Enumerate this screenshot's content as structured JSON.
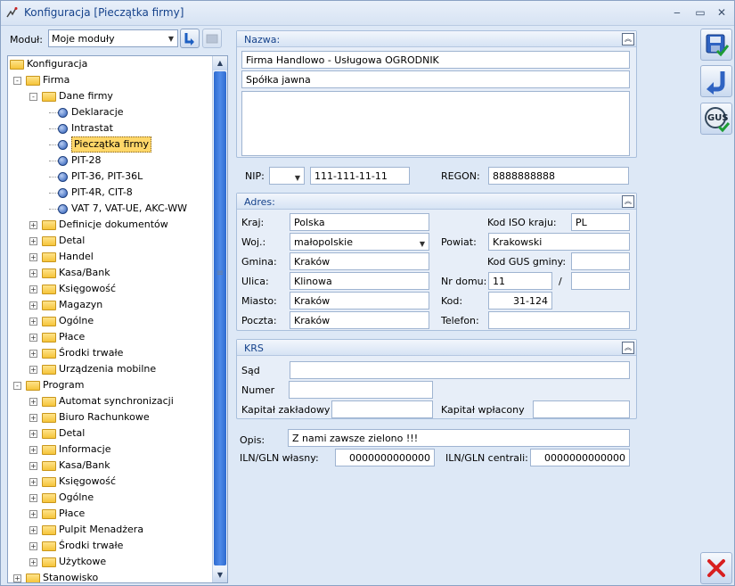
{
  "window": {
    "title": "Konfiguracja [Pieczątka firmy]",
    "controls": [
      "minimize",
      "maximize",
      "close"
    ]
  },
  "module": {
    "label": "Moduł:",
    "value": "Moje moduły"
  },
  "tree": {
    "items": [
      {
        "label": "Konfiguracja",
        "icon": "folder-icon",
        "level": 0
      },
      {
        "label": "Firma",
        "icon": "folder-icon",
        "level": 1,
        "expander": "-"
      },
      {
        "label": "Dane firmy",
        "icon": "folder-icon",
        "level": 2,
        "expander": "-"
      },
      {
        "label": "Deklaracje",
        "icon": "gear-icon",
        "level": 3
      },
      {
        "label": "Intrastat",
        "icon": "gear-icon",
        "level": 3
      },
      {
        "label": "Pieczątka firmy",
        "icon": "gear-icon",
        "level": 3,
        "selected": true
      },
      {
        "label": "PIT-28",
        "icon": "gear-icon",
        "level": 3
      },
      {
        "label": "PIT-36, PIT-36L",
        "icon": "gear-icon",
        "level": 3
      },
      {
        "label": "PIT-4R, CIT-8",
        "icon": "gear-icon",
        "level": 3
      },
      {
        "label": "VAT 7, VAT-UE, AKC-WW",
        "icon": "gear-icon",
        "level": 3
      },
      {
        "label": "Definicje dokumentów",
        "icon": "folder-icon",
        "level": 2,
        "expander": "+"
      },
      {
        "label": "Detal",
        "icon": "folder-icon",
        "level": 2,
        "expander": "+"
      },
      {
        "label": "Handel",
        "icon": "folder-icon",
        "level": 2,
        "expander": "+"
      },
      {
        "label": "Kasa/Bank",
        "icon": "folder-icon",
        "level": 2,
        "expander": "+"
      },
      {
        "label": "Księgowość",
        "icon": "folder-icon",
        "level": 2,
        "expander": "+"
      },
      {
        "label": "Magazyn",
        "icon": "folder-icon",
        "level": 2,
        "expander": "+"
      },
      {
        "label": "Ogólne",
        "icon": "folder-icon",
        "level": 2,
        "expander": "+"
      },
      {
        "label": "Płace",
        "icon": "folder-icon",
        "level": 2,
        "expander": "+"
      },
      {
        "label": "Środki trwałe",
        "icon": "folder-icon",
        "level": 2,
        "expander": "+"
      },
      {
        "label": "Urządzenia mobilne",
        "icon": "folder-icon",
        "level": 2,
        "expander": "+"
      },
      {
        "label": "Program",
        "icon": "folder-icon",
        "level": 1,
        "expander": "-"
      },
      {
        "label": "Automat synchronizacji",
        "icon": "folder-icon",
        "level": 2,
        "expander": "+"
      },
      {
        "label": "Biuro Rachunkowe",
        "icon": "folder-icon",
        "level": 2,
        "expander": "+"
      },
      {
        "label": "Detal",
        "icon": "folder-icon",
        "level": 2,
        "expander": "+"
      },
      {
        "label": "Informacje",
        "icon": "folder-icon",
        "level": 2,
        "expander": "+"
      },
      {
        "label": "Kasa/Bank",
        "icon": "folder-icon",
        "level": 2,
        "expander": "+"
      },
      {
        "label": "Księgowość",
        "icon": "folder-icon",
        "level": 2,
        "expander": "+"
      },
      {
        "label": "Ogólne",
        "icon": "folder-icon",
        "level": 2,
        "expander": "+"
      },
      {
        "label": "Płace",
        "icon": "folder-icon",
        "level": 2,
        "expander": "+"
      },
      {
        "label": "Pulpit Menadżera",
        "icon": "folder-icon",
        "level": 2,
        "expander": "+"
      },
      {
        "label": "Środki trwałe",
        "icon": "folder-icon",
        "level": 2,
        "expander": "+"
      },
      {
        "label": "Użytkowe",
        "icon": "folder-icon",
        "level": 2,
        "expander": "+"
      },
      {
        "label": "Stanowisko",
        "icon": "folder-icon",
        "level": 1,
        "expander": "+"
      }
    ]
  },
  "nazwa": {
    "title": "Nazwa:",
    "line1": "Firma Handlowo - Usługowa OGRODNIK",
    "line2": "Spółka jawna",
    "line3": ""
  },
  "ids": {
    "nip_label": "NIP:",
    "nip_prefix": "",
    "nip": "111-111-11-11",
    "regon_label": "REGON:",
    "regon": "8888888888"
  },
  "adres": {
    "title": "Adres:",
    "kraj_label": "Kraj:",
    "kraj": "Polska",
    "iso_label": "Kod ISO kraju:",
    "iso": "PL",
    "woj_label": "Woj.:",
    "woj": "małopolskie",
    "powiat_label": "Powiat:",
    "powiat": "Krakowski",
    "gmina_label": "Gmina:",
    "gmina": "Kraków",
    "gus_label": "Kod GUS gminy:",
    "gus": "",
    "ulica_label": "Ulica:",
    "ulica": "Klinowa",
    "nrdomu_label": "Nr domu:",
    "nrdomu": "11",
    "slash": "/",
    "nrlokalu": "",
    "miasto_label": "Miasto:",
    "miasto": "Kraków",
    "kod_label": "Kod:",
    "kod": "31-124",
    "poczta_label": "Poczta:",
    "poczta": "Kraków",
    "telefon_label": "Telefon:",
    "telefon": ""
  },
  "krs": {
    "title": "KRS",
    "sad_label": "Sąd",
    "sad": "",
    "numer_label": "Numer",
    "numer": "",
    "kz_label": "Kapitał zakładowy",
    "kz": "",
    "kw_label": "Kapitał wpłacony",
    "kw": ""
  },
  "opis": {
    "label": "Opis:",
    "value": "Z nami zawsze zielono !!!"
  },
  "gln": {
    "wlasny_label": "ILN/GLN własny:",
    "wlasny": "0000000000000",
    "centrali_label": "ILN/GLN centrali:",
    "centrali": "0000000000000"
  },
  "toolbar": {
    "save_icon": "save-icon",
    "undo_icon": "undo-icon",
    "gus_label": "GUS",
    "close_icon": "close-icon"
  },
  "colors": {
    "accent": "#15428b",
    "selection": "#ffd769",
    "window_bg": "#dde8f6",
    "close_red": "#d81f1f"
  }
}
